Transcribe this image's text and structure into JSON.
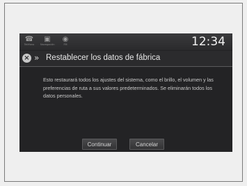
{
  "status_bar": {
    "icons": [
      {
        "icon": "phone-icon",
        "glyph": "☎",
        "label": "Teléfono"
      },
      {
        "icon": "navigation-icon",
        "glyph": "▣",
        "label": "Navegación"
      },
      {
        "icon": "fm-radio-icon",
        "glyph": "◉",
        "label": "FM"
      }
    ],
    "time": "12:34"
  },
  "dialog": {
    "close_glyph": "×",
    "breadcrumb_glyph": "»",
    "title": "Restablecer los datos de fábrica",
    "message": "Esto restaurará todos los ajustes del sistema, como el brillo, el volumen y las preferencias de ruta a sus valores predeterminados. Se eliminarán todos los datos personales.",
    "buttons": {
      "continue": "Continuar",
      "cancel": "Cancelar"
    }
  }
}
